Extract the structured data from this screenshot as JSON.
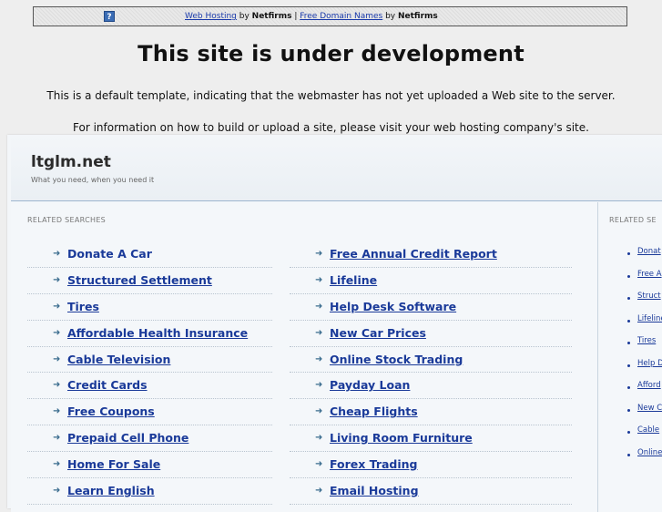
{
  "banner": {
    "icon": "question-mark-icon",
    "link1": "Web Hosting",
    "by1": " by ",
    "brand1": "Netfirms",
    "sep": " | ",
    "link2": "Free Domain Names",
    "by2": " by ",
    "brand2": "Netfirms"
  },
  "headline": "This site is under development",
  "paragraph1": "This is a default template, indicating that the webmaster has not yet uploaded a Web site to the server.",
  "paragraph2": "For information on how to build or upload a site, please visit your web hosting company's site.",
  "site": {
    "name": "ltglm.net",
    "tagline": "What you need, when you need it"
  },
  "main": {
    "section_title": "RELATED SEARCHES",
    "left_links": [
      "Donate A Car",
      "Structured Settlement",
      "Tires",
      "Affordable Health Insurance",
      "Cable Television",
      "Credit Cards",
      "Free Coupons",
      "Prepaid Cell Phone",
      "Home For Sale",
      "Learn English"
    ],
    "right_links": [
      "Free Annual Credit Report",
      "Lifeline",
      "Help Desk Software",
      "New Car Prices",
      "Online Stock Trading",
      "Payday Loan",
      "Cheap Flights",
      "Living Room Furniture",
      "Forex Trading",
      "Email Hosting"
    ],
    "arrow_glyph": "➜"
  },
  "sidebar": {
    "section_title": "RELATED SE",
    "links": [
      "Donat",
      "Free A",
      "Struct",
      "Lifeline",
      "Tires",
      "Help D",
      "Afford",
      "New C",
      "Cable",
      "Online"
    ]
  }
}
